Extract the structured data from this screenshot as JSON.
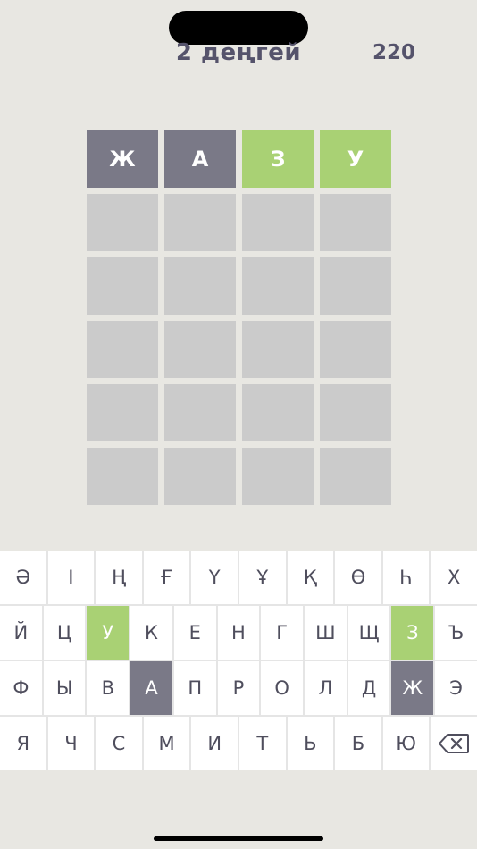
{
  "header": {
    "level_title": "2 деңгей",
    "score": "220"
  },
  "board": {
    "rows": [
      [
        {
          "letter": "Ж",
          "state": "absent"
        },
        {
          "letter": "А",
          "state": "absent"
        },
        {
          "letter": "З",
          "state": "correct"
        },
        {
          "letter": "У",
          "state": "correct"
        }
      ],
      [
        {
          "letter": "",
          "state": "empty"
        },
        {
          "letter": "",
          "state": "empty"
        },
        {
          "letter": "",
          "state": "empty"
        },
        {
          "letter": "",
          "state": "empty"
        }
      ],
      [
        {
          "letter": "",
          "state": "empty"
        },
        {
          "letter": "",
          "state": "empty"
        },
        {
          "letter": "",
          "state": "empty"
        },
        {
          "letter": "",
          "state": "empty"
        }
      ],
      [
        {
          "letter": "",
          "state": "empty"
        },
        {
          "letter": "",
          "state": "empty"
        },
        {
          "letter": "",
          "state": "empty"
        },
        {
          "letter": "",
          "state": "empty"
        }
      ],
      [
        {
          "letter": "",
          "state": "empty"
        },
        {
          "letter": "",
          "state": "empty"
        },
        {
          "letter": "",
          "state": "empty"
        },
        {
          "letter": "",
          "state": "empty"
        }
      ],
      [
        {
          "letter": "",
          "state": "empty"
        },
        {
          "letter": "",
          "state": "empty"
        },
        {
          "letter": "",
          "state": "empty"
        },
        {
          "letter": "",
          "state": "empty"
        }
      ]
    ]
  },
  "keyboard": {
    "rows": [
      [
        {
          "k": "Ә"
        },
        {
          "k": "І"
        },
        {
          "k": "Ң"
        },
        {
          "k": "Ғ"
        },
        {
          "k": "Ү"
        },
        {
          "k": "Ұ"
        },
        {
          "k": "Қ"
        },
        {
          "k": "Ө"
        },
        {
          "k": "Һ"
        },
        {
          "k": "Х"
        }
      ],
      [
        {
          "k": "Й"
        },
        {
          "k": "Ц"
        },
        {
          "k": "У",
          "state": "correct"
        },
        {
          "k": "К"
        },
        {
          "k": "Е"
        },
        {
          "k": "Н"
        },
        {
          "k": "Г"
        },
        {
          "k": "Ш"
        },
        {
          "k": "Щ"
        },
        {
          "k": "З",
          "state": "correct"
        },
        {
          "k": "Ъ"
        }
      ],
      [
        {
          "k": "Ф"
        },
        {
          "k": "Ы"
        },
        {
          "k": "В"
        },
        {
          "k": "А",
          "state": "absent"
        },
        {
          "k": "П"
        },
        {
          "k": "Р"
        },
        {
          "k": "О"
        },
        {
          "k": "Л"
        },
        {
          "k": "Д"
        },
        {
          "k": "Ж",
          "state": "absent"
        },
        {
          "k": "Э"
        }
      ],
      [
        {
          "k": "Я"
        },
        {
          "k": "Ч"
        },
        {
          "k": "С"
        },
        {
          "k": "М"
        },
        {
          "k": "И"
        },
        {
          "k": "Т"
        },
        {
          "k": "Ь"
        },
        {
          "k": "Б"
        },
        {
          "k": "Ю"
        },
        {
          "k": "",
          "icon": "backspace-icon"
        }
      ]
    ]
  },
  "colors": {
    "correct": "#a9d174",
    "absent": "#7a7987",
    "empty_tile": "#cbcbcb",
    "background": "#e8e7e2",
    "text": "#55536b"
  }
}
